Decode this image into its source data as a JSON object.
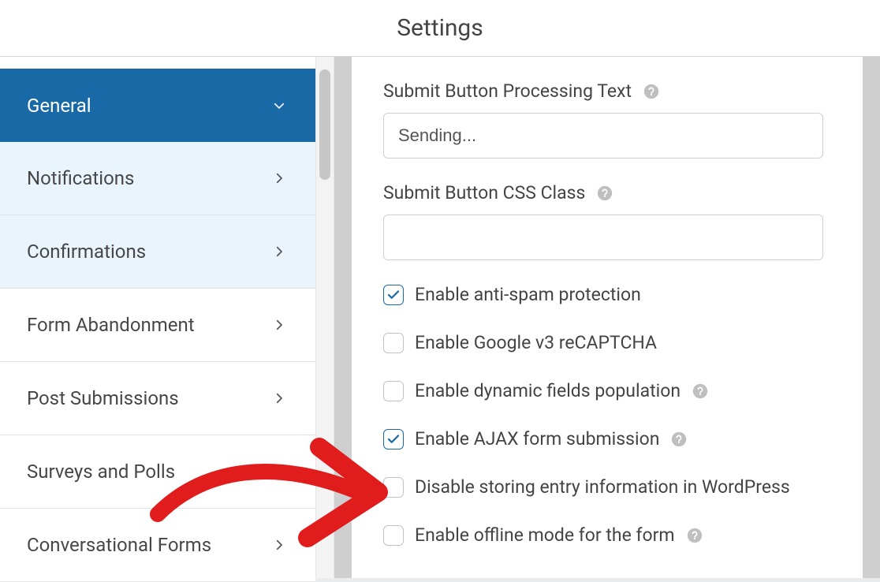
{
  "header": {
    "title": "Settings"
  },
  "sidebar": {
    "items": [
      {
        "label": "General",
        "active": true,
        "expandable": true,
        "sub": false
      },
      {
        "label": "Notifications",
        "active": false,
        "expandable": true,
        "sub": true
      },
      {
        "label": "Confirmations",
        "active": false,
        "expandable": true,
        "sub": true
      },
      {
        "label": "Form Abandonment",
        "active": false,
        "expandable": true,
        "sub": false
      },
      {
        "label": "Post Submissions",
        "active": false,
        "expandable": true,
        "sub": false
      },
      {
        "label": "Surveys and Polls",
        "active": false,
        "expandable": false,
        "sub": false
      },
      {
        "label": "Conversational Forms",
        "active": false,
        "expandable": true,
        "sub": false
      }
    ]
  },
  "form": {
    "submit_processing_label": "Submit Button Processing Text",
    "submit_processing_value": "Sending...",
    "submit_css_label": "Submit Button CSS Class",
    "submit_css_value": "",
    "checkboxes": [
      {
        "label": "Enable anti-spam protection",
        "checked": true,
        "help": false
      },
      {
        "label": "Enable Google v3 reCAPTCHA",
        "checked": false,
        "help": false
      },
      {
        "label": "Enable dynamic fields population",
        "checked": false,
        "help": true
      },
      {
        "label": "Enable AJAX form submission",
        "checked": true,
        "help": true
      },
      {
        "label": "Disable storing entry information in WordPress",
        "checked": false,
        "help": false
      },
      {
        "label": "Enable offline mode for the form",
        "checked": false,
        "help": true
      }
    ]
  },
  "icons": {
    "chevron_right": "chevron-right-icon",
    "chevron_down": "chevron-down-icon",
    "help": "help-icon",
    "check": "check-icon"
  },
  "colors": {
    "accent": "#1a69a7",
    "arrow": "#e11c1c"
  }
}
